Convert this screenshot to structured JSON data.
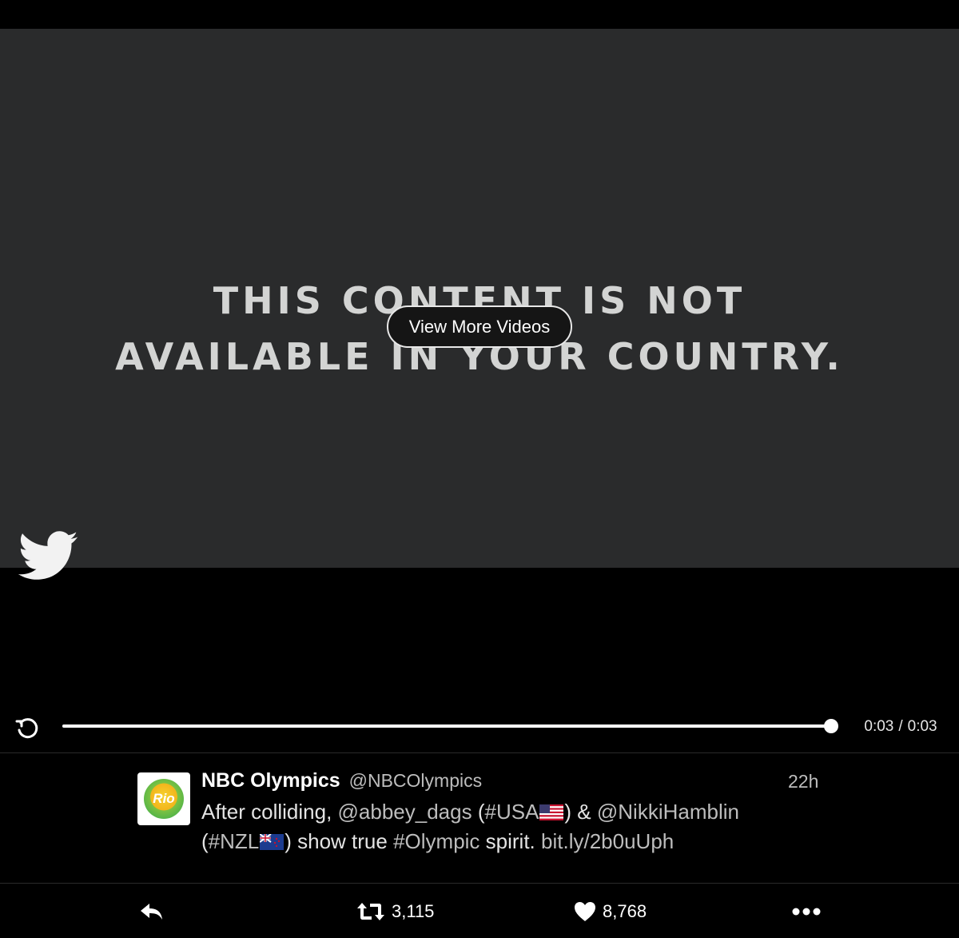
{
  "video": {
    "blocked_message_line1": "THIS CONTENT IS NOT",
    "blocked_message_line2": "AVAILABLE IN YOUR COUNTRY.",
    "view_more_label": "View More Videos",
    "watermark_icon": "twitter-bird-icon"
  },
  "player": {
    "replay_icon": "replay-icon",
    "progress_fraction": 1.0,
    "current_time": "0:03",
    "separator": "/",
    "duration": "0:03"
  },
  "tweet": {
    "avatar_text": "Rio",
    "name": "NBC Olympics",
    "handle": "@NBCOlympics",
    "time": "22h",
    "text_1": "After colliding, ",
    "mention_1": "@abbey_dags",
    "text_2": " (",
    "hashtag_1": "#USA",
    "text_3": ") & ",
    "mention_2": "@NikkiHamblin",
    "text_4": "(",
    "hashtag_2": "#NZL",
    "text_5": ") show true ",
    "hashtag_3": "#Olympic",
    "text_6": " spirit. ",
    "link": "bit.ly/2b0uUph"
  },
  "actions": {
    "reply_icon": "reply-icon",
    "retweet_icon": "retweet-icon",
    "retweet_count": "3,115",
    "like_icon": "heart-icon",
    "like_count": "8,768",
    "more_icon": "more-icon"
  },
  "colors": {
    "background": "#000000",
    "video_frame": "#2a2b2c",
    "text_primary": "#ffffff",
    "text_secondary": "#bdbdbd"
  }
}
